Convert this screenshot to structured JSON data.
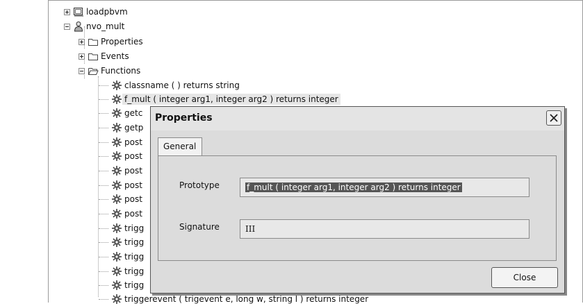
{
  "tree": {
    "items": [
      {
        "label": "loadpbvm",
        "icon": "library-icon"
      },
      {
        "label": "nvo_mult",
        "icon": "user-object-icon"
      },
      {
        "label": "Properties",
        "icon": "folder-icon"
      },
      {
        "label": "Events",
        "icon": "folder-icon"
      },
      {
        "label": "Functions",
        "icon": "folder-open-icon"
      },
      {
        "label": "classname ( )  returns string",
        "icon": "function-icon"
      },
      {
        "label": "f_mult ( integer arg1, integer arg2 )  returns integer",
        "icon": "function-icon"
      },
      {
        "label": "getc",
        "icon": "function-icon"
      },
      {
        "label": "getp",
        "icon": "function-icon"
      },
      {
        "label": "post",
        "icon": "function-icon"
      },
      {
        "label": "post",
        "icon": "function-icon"
      },
      {
        "label": "post",
        "icon": "function-icon"
      },
      {
        "label": "post",
        "icon": "function-icon"
      },
      {
        "label": "post",
        "icon": "function-icon"
      },
      {
        "label": "post",
        "icon": "function-icon"
      },
      {
        "label": "trigg",
        "icon": "function-icon"
      },
      {
        "label": "trigg",
        "icon": "function-icon"
      },
      {
        "label": "trigg",
        "icon": "function-icon"
      },
      {
        "label": "trigg",
        "icon": "function-icon"
      },
      {
        "label": "trigg",
        "icon": "function-icon"
      },
      {
        "label": "triggerevent ( trigevent e, long w, string l )  returns integer",
        "icon": "function-icon"
      }
    ]
  },
  "dialog": {
    "title": "Properties",
    "tab_general": "General",
    "prototype_label": "Prototype",
    "prototype_value": "f_mult ( integer arg1, integer arg2 )  returns integer",
    "signature_label": "Signature",
    "signature_value": "III",
    "close_label": "Close"
  }
}
